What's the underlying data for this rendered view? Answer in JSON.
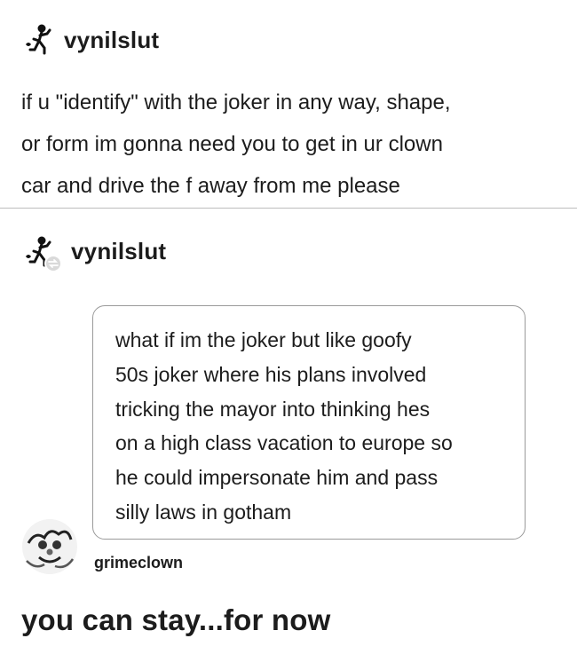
{
  "post": {
    "username": "vynilslut",
    "body_text": "if u \"identify\" with the joker in any way, shape,\nor form im gonna need you to get in ur clown\ncar and drive the f       away from me please"
  },
  "reblog": {
    "username": "vynilslut",
    "avatar_icon": "dancing-figure-avatar",
    "reblog_badge_icon": "reblog-icon",
    "quote_text": "what if im the joker but like goofy\n50s joker where his plans involved\ntricking the mayor into thinking hes\non a high class vacation to europe so\nhe could impersonate him and pass\nsilly laws in gotham"
  },
  "reply": {
    "username": "grimeclown",
    "avatar_icon": "clown-avatar",
    "text": "you can stay...for now"
  },
  "colors": {
    "text": "#1c1c1c",
    "divider": "#bdbdbd",
    "quote_border": "#9a9a9a"
  }
}
